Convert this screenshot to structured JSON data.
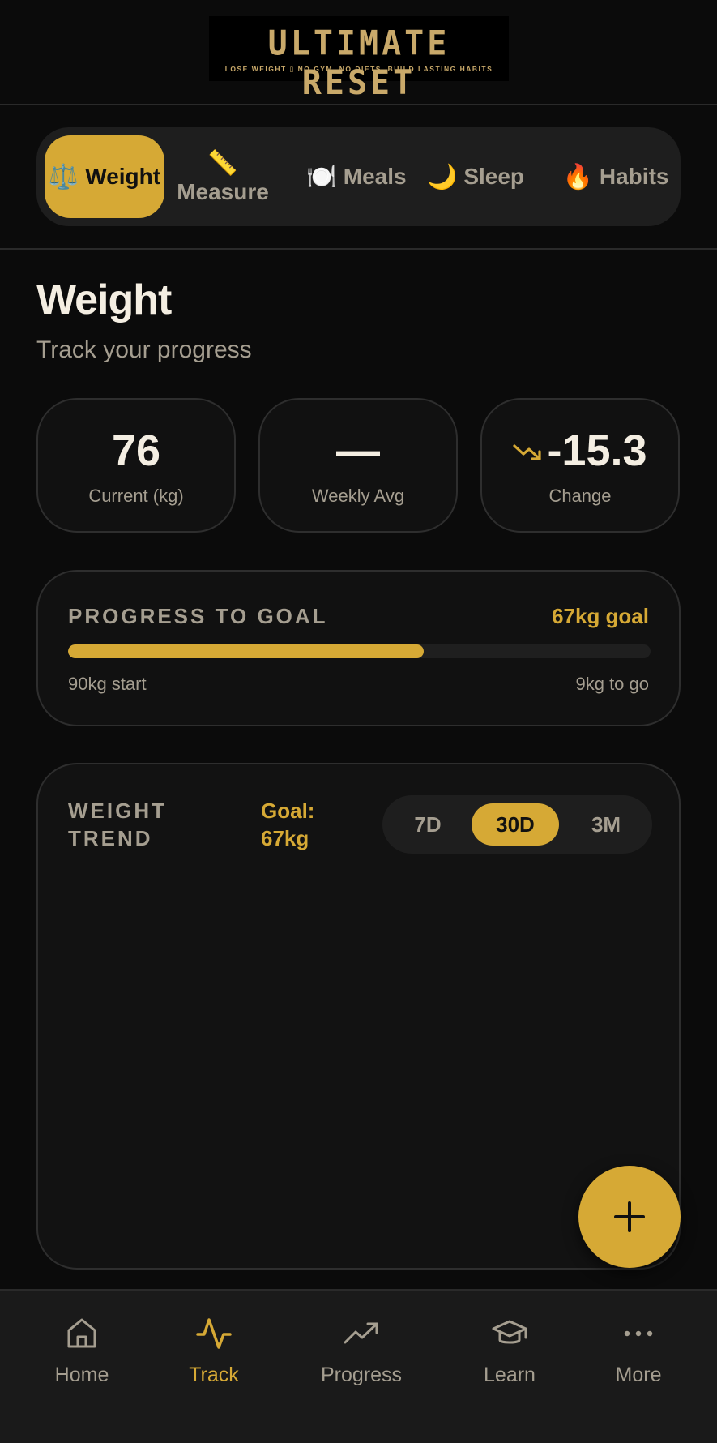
{
  "brand": {
    "title": "ULTIMATE RESET",
    "tagline": "LOSE WEIGHT ▯ NO GYM, NO DIETS, BUILD LASTING HABITS"
  },
  "tabs": [
    {
      "label": "Weight",
      "icon": "⚖️",
      "icon_name": "scale-icon",
      "active": true
    },
    {
      "label": "Measure",
      "icon": "📏",
      "icon_name": "ruler-icon",
      "active": false
    },
    {
      "label": "Meals",
      "icon": "🍽️",
      "icon_name": "plate-icon",
      "active": false
    },
    {
      "label": "Sleep",
      "icon": "🌙",
      "icon_name": "moon-icon",
      "active": false
    },
    {
      "label": "Habits",
      "icon": "🔥",
      "icon_name": "fire-icon",
      "active": false
    }
  ],
  "page": {
    "title": "Weight",
    "subtitle": "Track your progress"
  },
  "stats": {
    "current": {
      "value": "76",
      "label": "Current (kg)"
    },
    "weekly_avg": {
      "value": "—",
      "label": "Weekly Avg"
    },
    "change": {
      "value": "-15.3",
      "label": "Change"
    }
  },
  "progress": {
    "label": "PROGRESS TO GOAL",
    "goal": "67kg goal",
    "start": "90kg start",
    "to_go": "9kg to go",
    "fraction": 0.61
  },
  "trend": {
    "label": "WEIGHT TREND",
    "goal": "Goal: 67kg",
    "ranges": [
      {
        "label": "7D",
        "active": false
      },
      {
        "label": "30D",
        "active": true
      },
      {
        "label": "3M",
        "active": false
      }
    ]
  },
  "nav": [
    {
      "label": "Home",
      "icon_name": "home-icon",
      "active": false
    },
    {
      "label": "Track",
      "icon_name": "activity-icon",
      "active": true
    },
    {
      "label": "Progress",
      "icon_name": "trending-up-icon",
      "active": false
    },
    {
      "label": "Learn",
      "icon_name": "graduation-cap-icon",
      "active": false
    },
    {
      "label": "More",
      "icon_name": "more-dots-icon",
      "active": false
    }
  ],
  "colors": {
    "accent": "#d6a935",
    "background": "#0b0b0b",
    "card": "#111111",
    "muted_text": "#a59e90",
    "text": "#f4eee2"
  }
}
